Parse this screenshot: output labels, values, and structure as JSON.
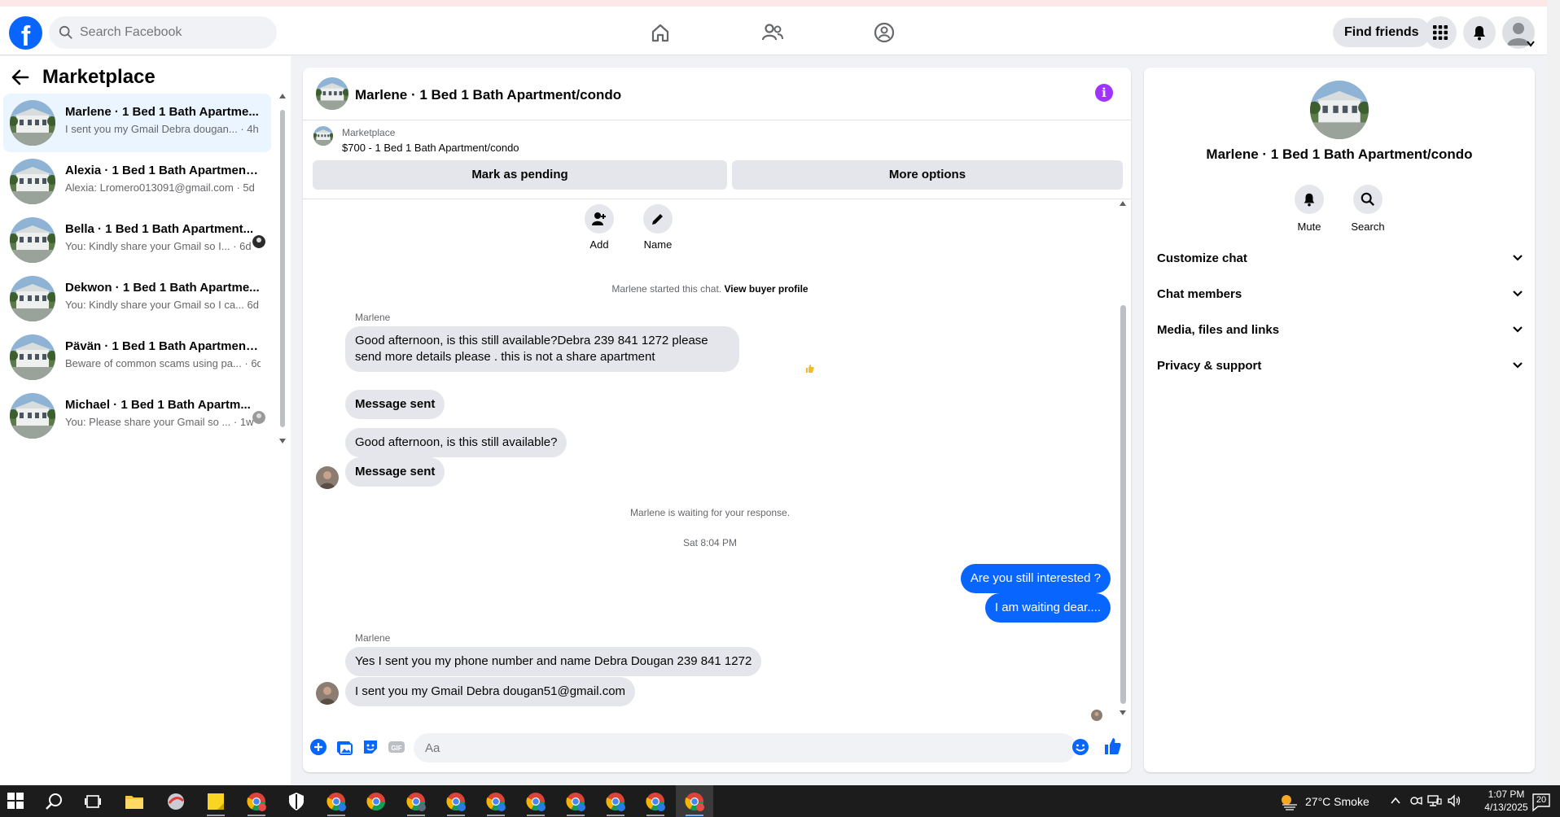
{
  "header": {
    "search_placeholder": "Search Facebook",
    "find_friends": "Find friends"
  },
  "sidebar": {
    "title": "Marketplace",
    "conversations": [
      {
        "name": "Marlene · 1 Bed 1 Bath Apartme...",
        "preview": "I sent you my Gmail Debra dougan...",
        "time": "· 4h",
        "active": true
      },
      {
        "name": "Alexia · 1 Bed 1 Bath Apartment/...",
        "preview": "Alexia: Lromero013091@gmail.com",
        "time": "· 5d",
        "active": false
      },
      {
        "name": "Bella · 1 Bed 1 Bath Apartment...",
        "preview": "You: Kindly share your Gmail so I...",
        "time": "· 6d",
        "active": false
      },
      {
        "name": "Dekwon · 1 Bed 1 Bath Apartme...",
        "preview": "You: Kindly share your Gmail so I ca...",
        "time": "6d",
        "active": false
      },
      {
        "name": "Pävän · 1 Bed 1 Bath Apartment/...",
        "preview": "Beware of common scams using pa...",
        "time": "· 6d",
        "active": false
      },
      {
        "name": "Michael · 1 Bed 1 Bath Apartm...",
        "preview": "You: Please share your Gmail so ...",
        "time": "· 1w",
        "active": false
      }
    ]
  },
  "chat": {
    "title": "Marlene · 1 Bed 1 Bath Apartment/condo",
    "listing_source": "Marketplace",
    "listing_detail": "$700 - 1 Bed 1 Bath Apartment/condo",
    "mark_pending": "Mark as pending",
    "more_options": "More options",
    "add_label": "Add",
    "name_label": "Name",
    "started_text": "Marlene started this chat.",
    "view_profile": "View buyer profile",
    "sender_1": "Marlene",
    "msg_1": "Good afternoon, is this still available?Debra 239 841 1272  please send more details please . this is not a share  apartment",
    "msg_2": "Message sent",
    "msg_3": "Good afternoon, is this still available?",
    "msg_4": "Message sent",
    "waiting": "Marlene is waiting for your response.",
    "timestamp": "Sat 8:04 PM",
    "out_1": "Are you still interested ?",
    "out_2": "I am waiting dear....",
    "sender_2": "Marlene",
    "msg_5": "Yes  I sent you my phone number and name Debra Dougan 239 841 1272",
    "msg_6": "I sent you my Gmail  Debra dougan51@gmail.com",
    "composer_placeholder": "Aa"
  },
  "details": {
    "title": "Marlene · 1 Bed 1 Bath Apartment/condo",
    "mute": "Mute",
    "search": "Search",
    "sections": [
      "Customize chat",
      "Chat members",
      "Media, files and links",
      "Privacy & support"
    ]
  },
  "taskbar": {
    "weather": "27°C  Smoke",
    "time": "1:07 PM",
    "date": "4/13/2025",
    "notifications": "20"
  },
  "colors": {
    "brand": "#0866ff",
    "info": "#a033ff",
    "outgoing": "#0866ff"
  }
}
